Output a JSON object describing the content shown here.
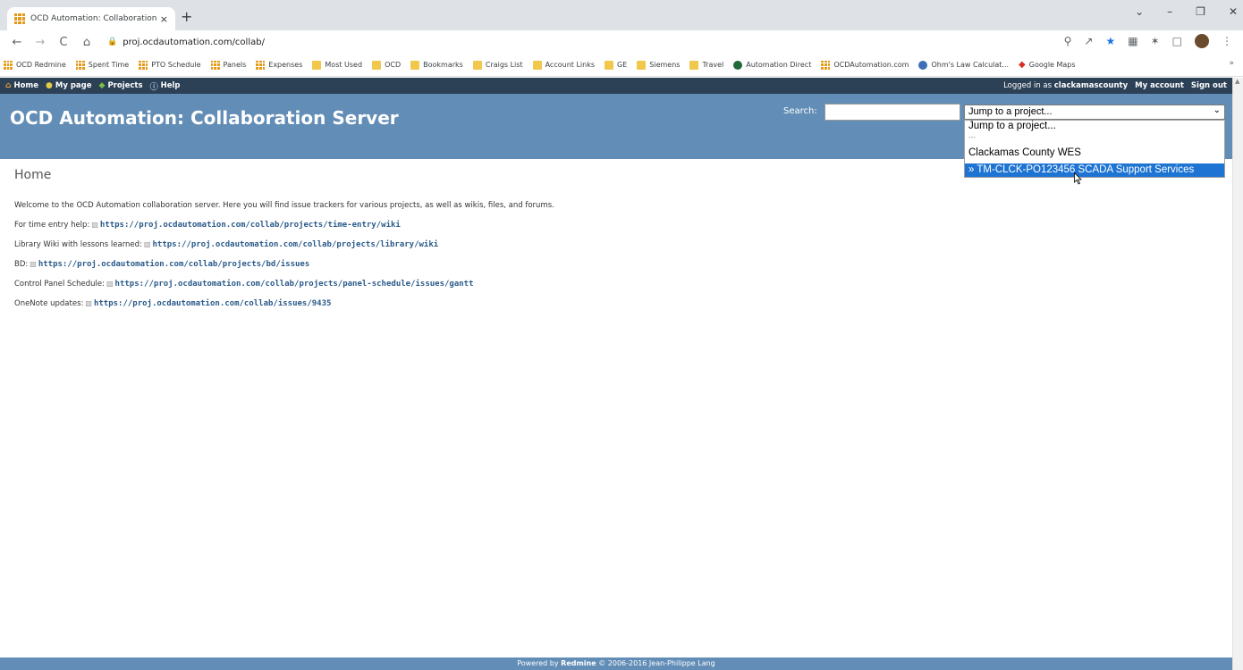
{
  "browser": {
    "tab_title": "OCD Automation: Collaboration",
    "tab_close": "×",
    "new_tab": "+",
    "window_controls": [
      "⌄",
      "–",
      "❐",
      "✕"
    ],
    "url": "proj.ocdautomation.com/collab/",
    "nav": {
      "back": "←",
      "forward": "→",
      "reload": "C",
      "home": "⌂"
    },
    "toolbar_icons": [
      "zoom-icon",
      "share-icon",
      "bookmark-star-icon",
      "extension-icon",
      "puzzle-icon",
      "sidebar-icon",
      "profile-avatar"
    ],
    "bookmarks": [
      {
        "label": "OCD Redmine",
        "icon": "grid"
      },
      {
        "label": "Spent Time",
        "icon": "grid"
      },
      {
        "label": "PTO Schedule",
        "icon": "grid"
      },
      {
        "label": "Panels",
        "icon": "grid"
      },
      {
        "label": "Expenses",
        "icon": "grid"
      },
      {
        "label": "Most Used",
        "icon": "folder"
      },
      {
        "label": "OCD",
        "icon": "folder"
      },
      {
        "label": "Bookmarks",
        "icon": "folder"
      },
      {
        "label": "Craigs List",
        "icon": "folder"
      },
      {
        "label": "Account Links",
        "icon": "folder"
      },
      {
        "label": "GE",
        "icon": "folder"
      },
      {
        "label": "Siemens",
        "icon": "folder"
      },
      {
        "label": "Travel",
        "icon": "folder"
      },
      {
        "label": "Automation Direct",
        "icon": "circle"
      },
      {
        "label": "OCDAutomation.com",
        "icon": "grid"
      },
      {
        "label": "Ohm's Law Calculat...",
        "icon": "ohm"
      },
      {
        "label": "Google Maps",
        "icon": "pin"
      }
    ],
    "bookmarks_more": "»"
  },
  "topmenu": {
    "items": [
      {
        "label": "Home",
        "icon": "home-icon"
      },
      {
        "label": "My page",
        "icon": "user-icon"
      },
      {
        "label": "Projects",
        "icon": "projects-icon"
      },
      {
        "label": "Help",
        "icon": "help-icon"
      }
    ],
    "logged_in_prefix": "Logged in as",
    "username": "clackamascounty",
    "my_account": "My account",
    "sign_out": "Sign out"
  },
  "header": {
    "title": "OCD Automation: Collaboration Server",
    "search_label": "Search:",
    "search_value": "",
    "jump_selected": "Jump to a project...",
    "jump_options": [
      {
        "label": "Jump to a project...",
        "kind": "normal"
      },
      {
        "label": "---",
        "kind": "sep"
      },
      {
        "label": "Clackamas County WES",
        "kind": "group"
      },
      {
        "label": "» TM-CLCK-PO123456 SCADA Support Services",
        "kind": "selected"
      }
    ]
  },
  "content": {
    "heading": "Home",
    "intro": "Welcome to the OCD Automation collaboration server. Here you will find issue trackers for various projects, as well as wikis, files, and forums.",
    "links": [
      {
        "prefix": "For time entry help:",
        "url": "https://proj.ocdautomation.com/collab/projects/time-entry/wiki"
      },
      {
        "prefix": "Library Wiki with lessons learned:",
        "url": "https://proj.ocdautomation.com/collab/projects/library/wiki"
      },
      {
        "prefix": "BD:",
        "url": "https://proj.ocdautomation.com/collab/projects/bd/issues"
      },
      {
        "prefix": "Control Panel Schedule:",
        "url": "https://proj.ocdautomation.com/collab/projects/panel-schedule/issues/gantt"
      },
      {
        "prefix": "OneNote updates:",
        "url": "https://proj.ocdautomation.com/collab/issues/9435"
      }
    ]
  },
  "footer": {
    "prefix": "Powered by",
    "brand": "Redmine",
    "suffix": "© 2006-2016 Jean-Philippe Lang"
  }
}
